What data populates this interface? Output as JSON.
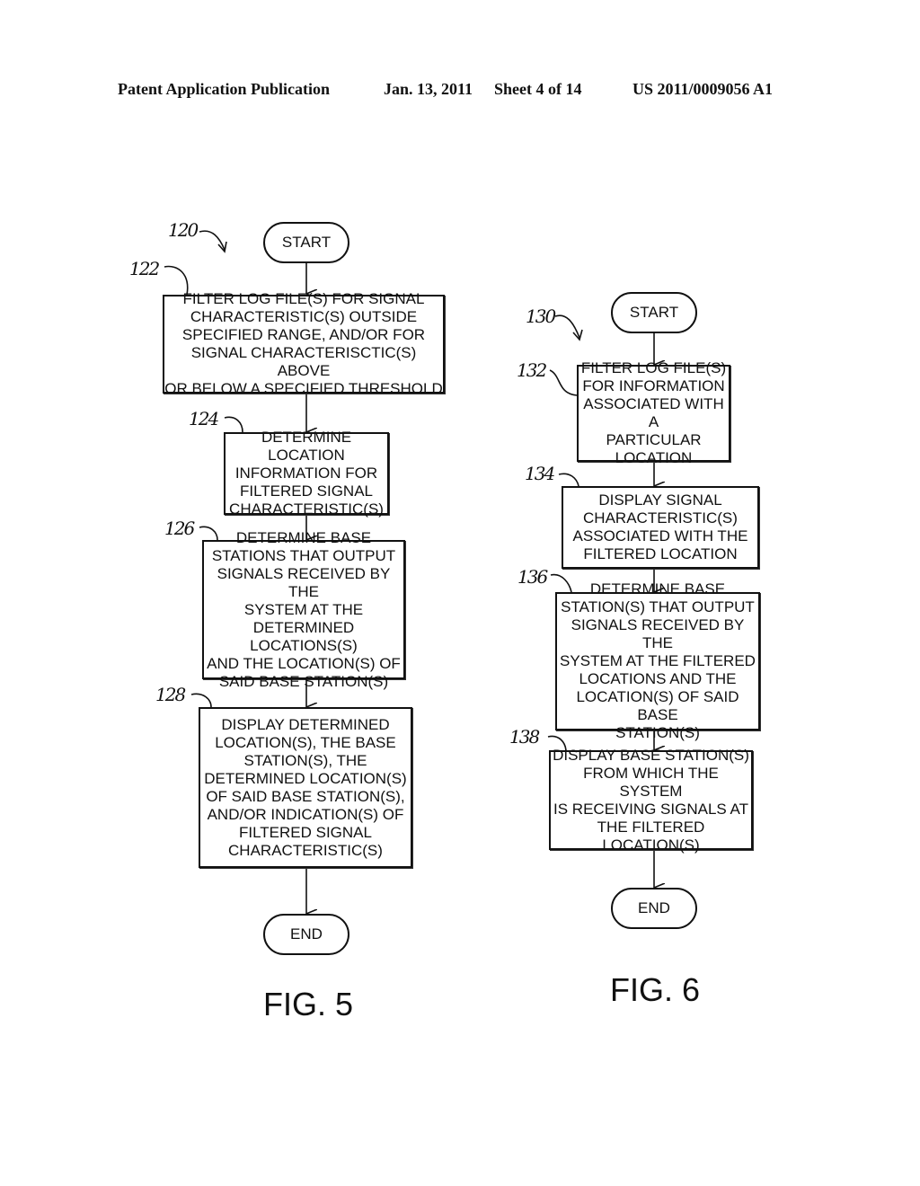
{
  "header": {
    "publication": "Patent Application Publication",
    "date": "Jan. 13, 2011",
    "sheet": "Sheet 4 of 14",
    "number": "US 2011/0009056 A1"
  },
  "fig5": {
    "ref": "120",
    "label": "FIG. 5",
    "start": "START",
    "end": "END",
    "steps": [
      {
        "ref": "122",
        "text": "FILTER LOG FILE(S) FOR SIGNAL\nCHARACTERISTIC(S) OUTSIDE\nSPECIFIED RANGE, AND/OR FOR\nSIGNAL CHARACTERISCTIC(S) ABOVE\nOR BELOW A SPECIFIED THRESHOLD"
      },
      {
        "ref": "124",
        "text": "DETERMINE LOCATION\nINFORMATION FOR\nFILTERED SIGNAL\nCHARACTERISTIC(S)"
      },
      {
        "ref": "126",
        "text": "DETERMINE BASE\nSTATIONS THAT OUTPUT\nSIGNALS RECEIVED BY THE\nSYSTEM AT THE\nDETERMINED LOCATIONS(S)\nAND THE LOCATION(S) OF\nSAID BASE STATION(S)"
      },
      {
        "ref": "128",
        "text": "DISPLAY DETERMINED\nLOCATION(S), THE BASE\nSTATION(S), THE\nDETERMINED LOCATION(S)\nOF SAID BASE STATION(S),\nAND/OR INDICATION(S) OF\nFILTERED SIGNAL\nCHARACTERISTIC(S)"
      }
    ]
  },
  "fig6": {
    "ref": "130",
    "label": "FIG. 6",
    "start": "START",
    "end": "END",
    "steps": [
      {
        "ref": "132",
        "text": "FILTER LOG FILE(S)\nFOR INFORMATION\nASSOCIATED WITH A\nPARTICULAR\nLOCATION"
      },
      {
        "ref": "134",
        "text": "DISPLAY SIGNAL\nCHARACTERISTIC(S)\nASSOCIATED WITH THE\nFILTERED LOCATION"
      },
      {
        "ref": "136",
        "text": "DETERMINE BASE\nSTATION(S) THAT OUTPUT\nSIGNALS RECEIVED BY THE\nSYSTEM AT THE FILTERED\nLOCATIONS AND THE\nLOCATION(S) OF SAID BASE\nSTATION(S)"
      },
      {
        "ref": "138",
        "text": "DISPLAY BASE STATION(S)\nFROM WHICH THE SYSTEM\nIS RECEIVING SIGNALS AT\nTHE FILTERED\nLOCATION(S)"
      }
    ]
  }
}
